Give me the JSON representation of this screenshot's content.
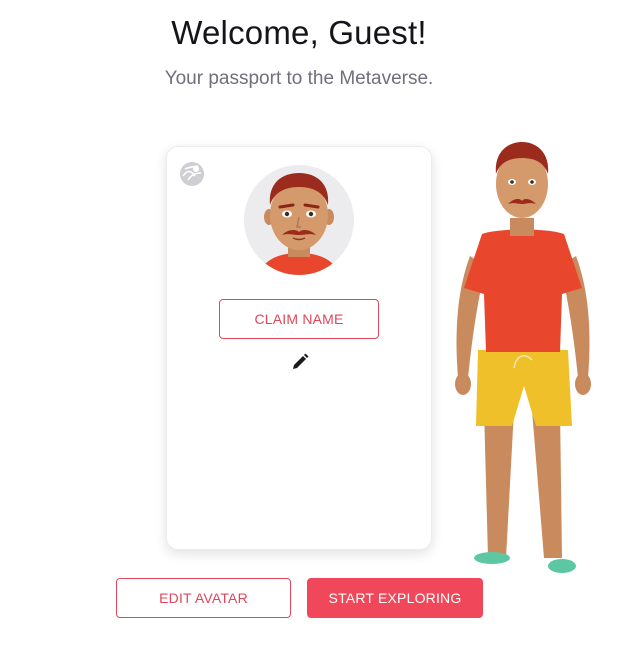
{
  "header": {
    "title": "Welcome, Guest!",
    "subtitle": "Your passport to the Metaverse."
  },
  "card": {
    "network_icon": "network-globe-icon",
    "avatar_icon": "avatar-face",
    "claim_name_label": "CLAIM NAME",
    "edit_icon": "pencil-icon"
  },
  "actions": {
    "edit_avatar_label": "EDIT AVATAR",
    "start_exploring_label": "START EXPLORING"
  },
  "colors": {
    "accent": "#f0485a",
    "title": "#16141a",
    "subtitle": "#736e7d"
  }
}
